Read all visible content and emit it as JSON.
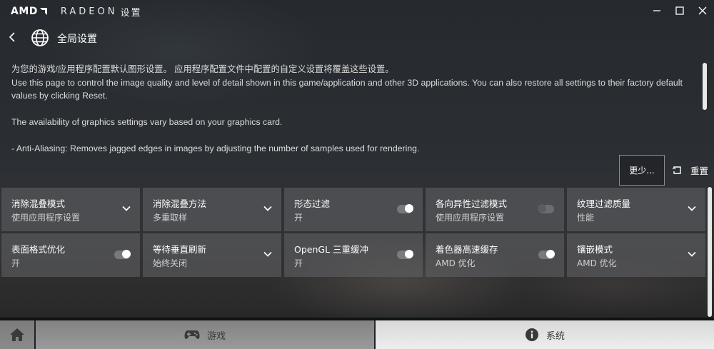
{
  "app": {
    "brand": "AMD",
    "product": "RADEON",
    "title_cn": "设置"
  },
  "header": {
    "page_title": "全局设置"
  },
  "description": {
    "line_cn": "为您的游戏/应用程序配置默认图形设置。 应用程序配置文件中配置的自定义设置将覆盖这些设置。",
    "line_en": "Use this page to control the image quality and level of detail shown in this game/application and other 3D applications. You can also restore all settings to their factory default values by clicking Reset.",
    "line_availability": "The availability of graphics settings vary based on your graphics card.",
    "line_aa": "- Anti-Aliasing: Removes jagged edges in images by adjusting the number of samples used for rendering."
  },
  "actions": {
    "more_label": "更少...",
    "reset_label": "重置"
  },
  "tiles": [
    {
      "label": "消除混叠模式",
      "value": "使用应用程序设置",
      "control": "dropdown"
    },
    {
      "label": "消除混叠方法",
      "value": "多重取样",
      "control": "dropdown"
    },
    {
      "label": "形态过滤",
      "value": "开",
      "control": "toggle",
      "on": true
    },
    {
      "label": "各向异性过滤模式",
      "value": "使用应用程序设置",
      "control": "toggle",
      "on": false
    },
    {
      "label": "纹理过滤质量",
      "value": "性能",
      "control": "dropdown"
    },
    {
      "label": "表面格式优化",
      "value": "开",
      "control": "toggle",
      "on": true
    },
    {
      "label": "等待垂直刷新",
      "value": "始终关闭",
      "control": "dropdown"
    },
    {
      "label": "OpenGL 三重缓冲",
      "value": "开",
      "control": "toggle",
      "on": true
    },
    {
      "label": "着色器高速缓存",
      "value": "AMD 优化",
      "control": "toggle",
      "on": true
    },
    {
      "label": "镶嵌模式",
      "value": "AMD 优化",
      "control": "dropdown"
    }
  ],
  "bottom_nav": {
    "games_label": "游戏",
    "system_label": "系统"
  },
  "icons": {
    "home": "home-icon",
    "gamepad": "gamepad-icon",
    "info": "info-icon",
    "globe": "globe-icon"
  }
}
